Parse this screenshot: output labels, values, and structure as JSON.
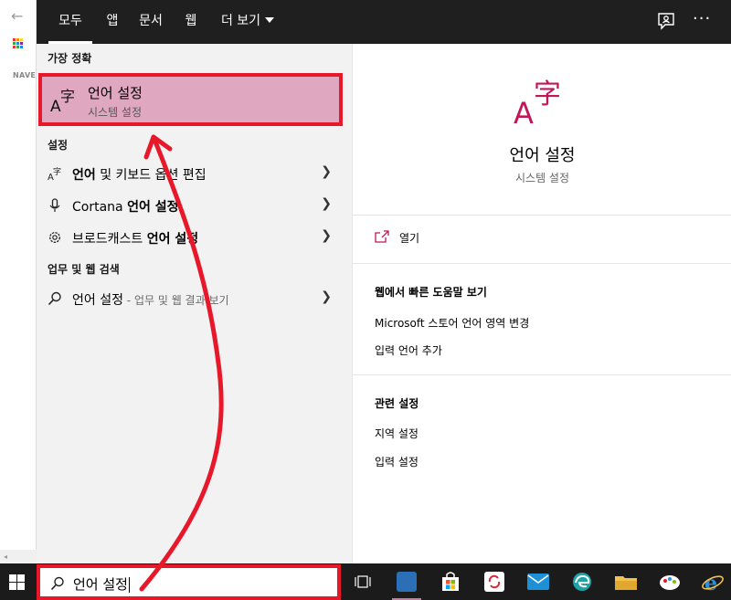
{
  "background_window": {
    "nav_label": "NAVE",
    "back_glyph": "←",
    "scroll_glyph": "◂"
  },
  "topbar": {
    "tabs": [
      {
        "label": "모두",
        "active": true
      },
      {
        "label": "앱",
        "active": false
      },
      {
        "label": "문서",
        "active": false
      },
      {
        "label": "웹",
        "active": false
      },
      {
        "label": "더 보기",
        "active": false,
        "has_dropdown": true
      }
    ],
    "feedback_icon": "feedback-icon",
    "more_label": "···"
  },
  "left": {
    "best_match_heading": "가장 정확",
    "best_match": {
      "title": "언어 설정",
      "subtitle": "시스템 설정",
      "icon": "language-icon"
    },
    "settings_heading": "설정",
    "settings_items": [
      {
        "icon": "language-icon",
        "label": "언어 및 키보드 옵션 편집",
        "bold": "언어",
        "rest": " 및 키보드 옵션 편집"
      },
      {
        "icon": "microphone-icon",
        "label_prefix": "Cortana ",
        "label_bold": "언어 설정"
      },
      {
        "icon": "gear-icon",
        "label_prefix": "브로드캐스트 ",
        "label_bold": "언어 설정"
      }
    ],
    "web_heading": "업무 및 웹 검색",
    "web_item": {
      "icon": "search-icon",
      "label": "언어 설정",
      "suffix": " - 업무 및 웹 결과 보기"
    }
  },
  "right": {
    "title": "언어 설정",
    "subtitle": "시스템 설정",
    "open_label": "열기",
    "web_heading": "웹에서 빠른 도움말 보기",
    "web_links": [
      "Microsoft 스토어 언어 영역 변경",
      "입력 언어 추가"
    ],
    "related_heading": "관련 설정",
    "related_links": [
      "지역 설정",
      "입력 설정"
    ]
  },
  "taskbar": {
    "search_value": "언어 설정",
    "apps": [
      {
        "icon": "task-view-icon",
        "color": "#1b1b1b"
      },
      {
        "icon": "hangul-app-icon",
        "color": "#2d6fb7",
        "active": true
      },
      {
        "icon": "store-icon",
        "color": "#ffffff"
      },
      {
        "icon": "sync-app-icon",
        "color": "#ffffff"
      },
      {
        "icon": "mail-icon",
        "color": "#1e90d6"
      },
      {
        "icon": "edge-icon",
        "color": "#1fa3a8"
      },
      {
        "icon": "file-explorer-icon",
        "color": "#f2c14e"
      },
      {
        "icon": "paint-app-icon",
        "color": "#ffffff"
      },
      {
        "icon": "internet-explorer-icon",
        "color": "#2a8fde"
      }
    ]
  },
  "colors": {
    "accent": "#c11758",
    "highlight_bg": "#e0a7c1",
    "annotation_red": "#e8182b",
    "topbar": "#1f1f1f",
    "taskbar": "#1b1b1b"
  }
}
